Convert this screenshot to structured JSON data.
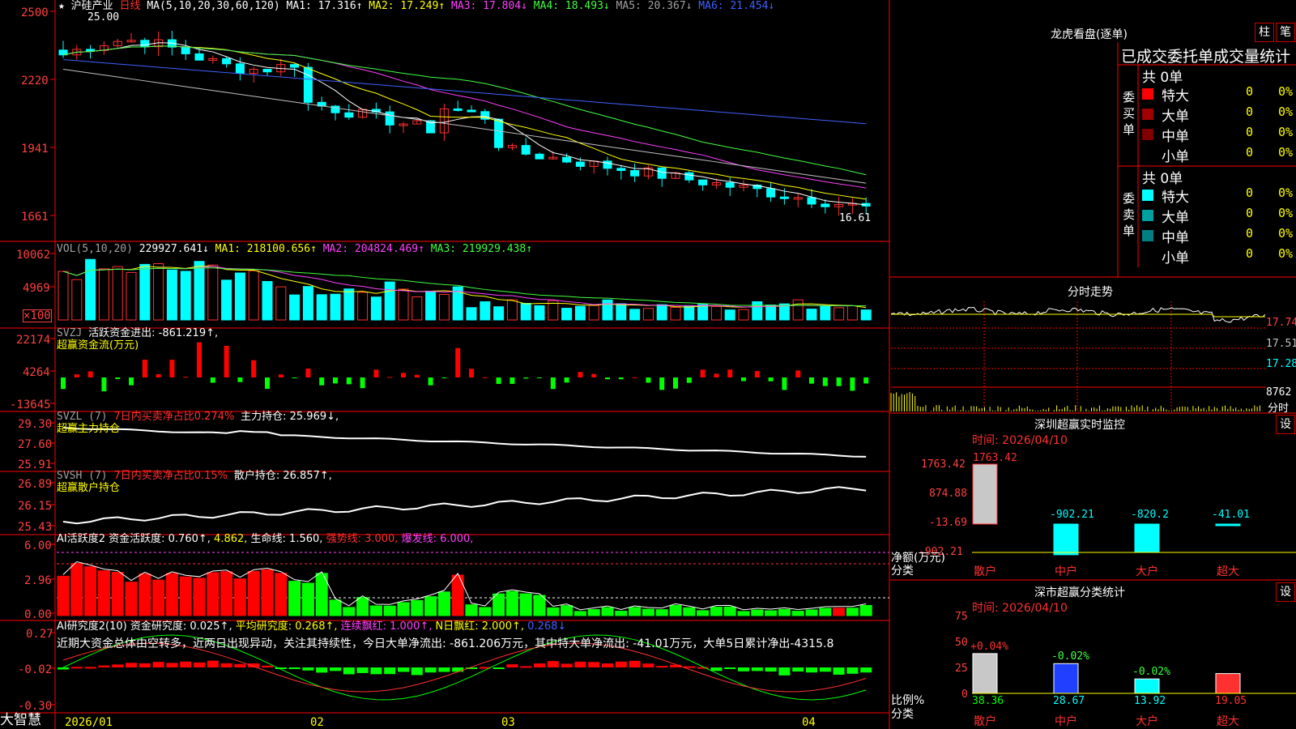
{
  "stock": {
    "star": "★",
    "name": "沪硅产业",
    "period": "日线",
    "ma_params": "MA(5,10,20,30,60,120)",
    "ma": [
      {
        "label": "MA1: 17.316↑",
        "color": "#ffffff"
      },
      {
        "label": "MA2: 17.249↑",
        "color": "#ffff00"
      },
      {
        "label": "MA3: 17.804↓",
        "color": "#ff40ff"
      },
      {
        "label": "MA4: 18.493↓",
        "color": "#40ff40"
      },
      {
        "label": "MA5: 20.367↓",
        "color": "#c0c0c0"
      },
      {
        "label": "MA6: 21.454↓",
        "color": "#4060ff"
      }
    ],
    "high_mark": "25.00",
    "low_mark": "16.61"
  },
  "axes": {
    "price": [
      "2500",
      "2220",
      "1941",
      "1661"
    ],
    "vol": [
      "10062",
      "4969",
      "×100"
    ],
    "svzj": [
      "22174",
      "4264",
      "-13645"
    ],
    "svzl": [
      "29.30",
      "27.60",
      "25.91"
    ],
    "svsh": [
      "26.89",
      "26.15",
      "25.43"
    ],
    "ai": [
      "6.00",
      "2.96",
      "0.00"
    ],
    "ai2": [
      "0.27",
      "-0.02",
      "-0.30"
    ]
  },
  "vol_header": {
    "name": "VOL(5,10,20)",
    "v": "229927.641↓",
    "ma1": "MA1: 218100.656↑",
    "ma2": "MA2: 204824.469↑",
    "ma3": "MA3: 219929.438↑"
  },
  "svzj_header": {
    "name": "SVZJ",
    "label": "活跃资金进出: -861.219↑,",
    "sub": "超赢资金流(万元)"
  },
  "svzl_header": {
    "name": "SVZL (7)",
    "red": "7日内买卖净占比0.274%",
    "label": "主力持仓: 25.969↓,",
    "sub": "超赢主力持仓"
  },
  "svsh_header": {
    "name": "SVSH (7)",
    "red": "7日内买卖净占比0.15%",
    "label": "散户持仓: 26.857↑,",
    "sub": "超赢散户持仓"
  },
  "ai_header": {
    "name": "AI活跃度2",
    "a": "资金活跃度: 0.760↑,",
    "b": "4.862,",
    "c": "生命线: 1.560,",
    "d": "强势线: 3.000,",
    "e": "爆发线: 6.000,"
  },
  "ai2_header": {
    "name": "AI研究度2(10)",
    "a": "资金研究度: 0.025↑,",
    "b": "平均研究度: 0.268↑,",
    "c": "连续飘红: 1.000↑,",
    "d": "N日飘红: 2.000↑,",
    "e": "0.268↓",
    "text": "近期大资金总体由空转多，近两日出现异动，关注其持续性，今日大单净流出: -861.206万元，其中特大单净流出: -41.01万元，大单5日累计净出-4315.8"
  },
  "date_axis": {
    "start": "2026/01",
    "m2": "02",
    "m3": "03",
    "m4": "04",
    "logo": "大智慧"
  },
  "dragon_tiger": {
    "title": "龙虎看盘(逐单)",
    "btn1": "柱",
    "btn2": "笔",
    "tabs": "已成交委托单成交量统计",
    "buy": {
      "label": "委买单",
      "total": "共 0单",
      "rows": [
        {
          "name": "特大",
          "v": "0",
          "p": "0%",
          "color": "#ff0000"
        },
        {
          "name": "大单",
          "v": "0",
          "p": "0%",
          "color": "#a00000"
        },
        {
          "name": "中单",
          "v": "0",
          "p": "0%",
          "color": "#800000"
        },
        {
          "name": "小单",
          "v": "0",
          "p": "0%",
          "color": ""
        }
      ]
    },
    "sell": {
      "label": "委卖单",
      "total": "共 0单",
      "rows": [
        {
          "name": "特大",
          "v": "0",
          "p": "0%",
          "color": "#00ffff"
        },
        {
          "name": "大单",
          "v": "0",
          "p": "0%",
          "color": "#00a0a0"
        },
        {
          "name": "中单",
          "v": "0",
          "p": "0%",
          "color": "#008080"
        },
        {
          "name": "小单",
          "v": "0",
          "p": "0%",
          "color": ""
        }
      ]
    }
  },
  "intraday": {
    "title": "分时走势",
    "p1": "17.74",
    "p2": "17.51",
    "p3": "17.28",
    "vol": "8762",
    "unit": "分时"
  },
  "sz_monitor": {
    "title": "深圳超赢实时监控",
    "btn": "设",
    "time": "时间: 2026/04/10",
    "y": [
      "1763.42",
      "874.88",
      "-13.69",
      "-902.21"
    ],
    "ylab": "净额(万元)",
    "xlab": "分类",
    "cats": [
      "散户",
      "中户",
      "大户",
      "超大"
    ],
    "values": [
      1763.42,
      -902.21,
      -820.2,
      -41.01
    ],
    "labels": [
      "1763.42",
      "-902.21",
      "-820.2",
      "-41.01"
    ]
  },
  "sz_stats": {
    "title": "深市超赢分类统计",
    "btn": "设",
    "time": "时间: 2026/04/10",
    "y": [
      "75",
      "50",
      "25",
      "0"
    ],
    "ylab": "比例%",
    "xlab": "分类",
    "cats": [
      "散户",
      "中户",
      "大户",
      "超大"
    ],
    "values": [
      38.36,
      28.67,
      13.92,
      19.05
    ],
    "changes": [
      "+0.04%",
      "-0.02%",
      "-0.02%",
      ""
    ],
    "labels": [
      "38.36",
      "28.67",
      "13.92",
      "19.05"
    ]
  }
}
